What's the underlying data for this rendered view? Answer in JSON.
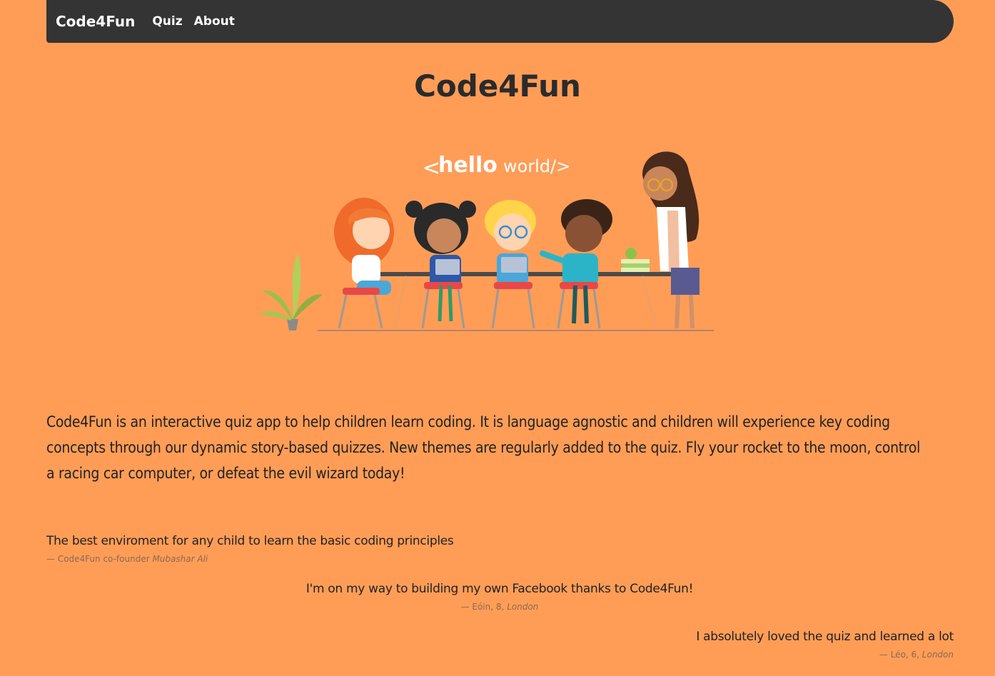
{
  "nav": {
    "brand": "Code4Fun",
    "links": [
      "Quiz",
      "About"
    ]
  },
  "main": {
    "title": "Code4Fun",
    "hero_text_left": "hello",
    "hero_text_right": "world/>",
    "hero_text_lt": "<",
    "intro": "Code4Fun is an interactive quiz app to help children learn coding. It is language agnostic and children will experience key coding concepts through our dynamic story-based quizzes. New themes are regularly added to the quiz. Fly your rocket to the moon, control a racing car computer, or defeat the evil wizard today!"
  },
  "testimonials": [
    {
      "quote": "The best enviroment for any child to learn the basic coding principles",
      "attribution": "— Code4Fun co-founder ",
      "source": "Mubashar Ali"
    },
    {
      "quote": "I'm on my way to building my own Facebook thanks to Code4Fun!",
      "attribution": "— Eóin, 8, ",
      "source": "London"
    },
    {
      "quote": "I absolutely loved the quiz and learned a lot",
      "attribution": "— Léo, 6, ",
      "source": "London"
    }
  ],
  "colors": {
    "background": "#ff9d57",
    "navbar": "#343434",
    "text": "#222222"
  }
}
